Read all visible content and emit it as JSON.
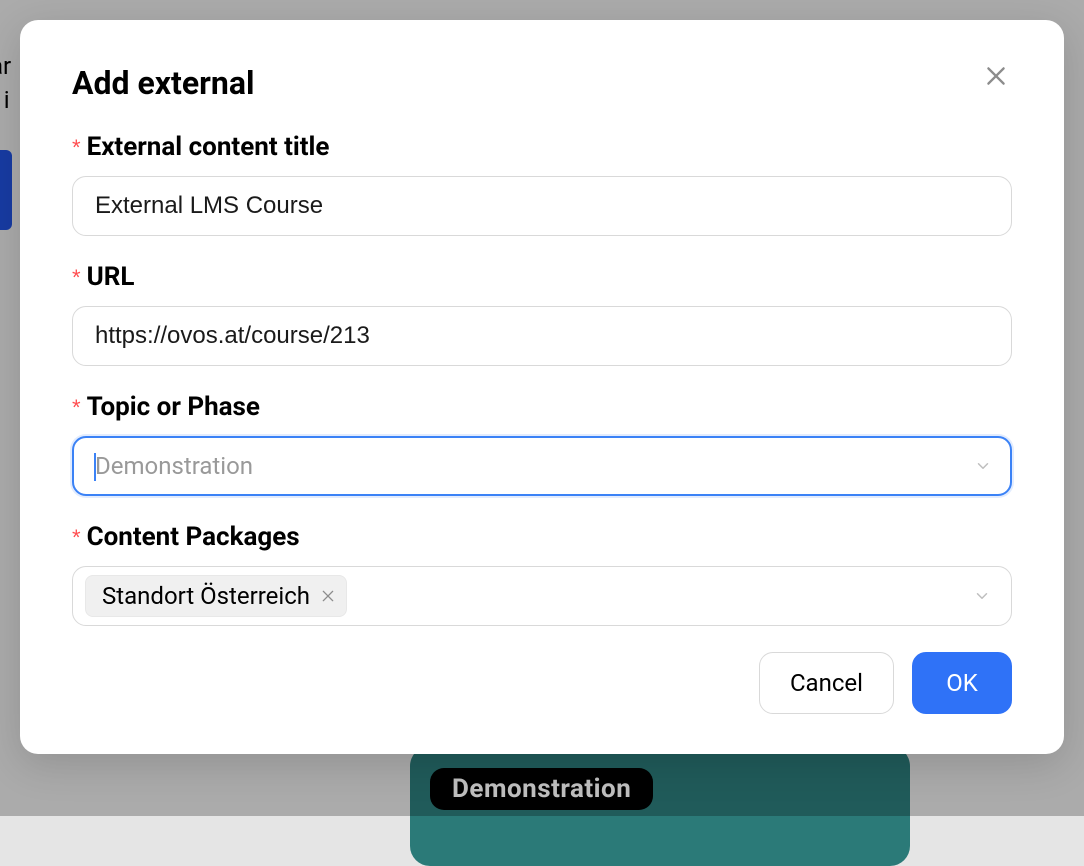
{
  "modal": {
    "title": "Add external",
    "close_label": "Close",
    "fields": {
      "title": {
        "label": "External content title",
        "value": "External LMS Course",
        "required": true
      },
      "url": {
        "label": "URL",
        "value": "https://ovos.at/course/213",
        "required": true
      },
      "topic": {
        "label": "Topic or Phase",
        "value": "Demonstration",
        "required": true,
        "focused": true
      },
      "packages": {
        "label": "Content Packages",
        "required": true,
        "tags": [
          {
            "label": "Standort Österreich"
          }
        ]
      }
    },
    "footer": {
      "cancel": "Cancel",
      "ok": "OK"
    }
  },
  "background": {
    "pill_text": "Demonstration"
  },
  "colors": {
    "primary": "#2f72f7",
    "danger": "#ff4d4f",
    "border": "#d9d9d9"
  }
}
